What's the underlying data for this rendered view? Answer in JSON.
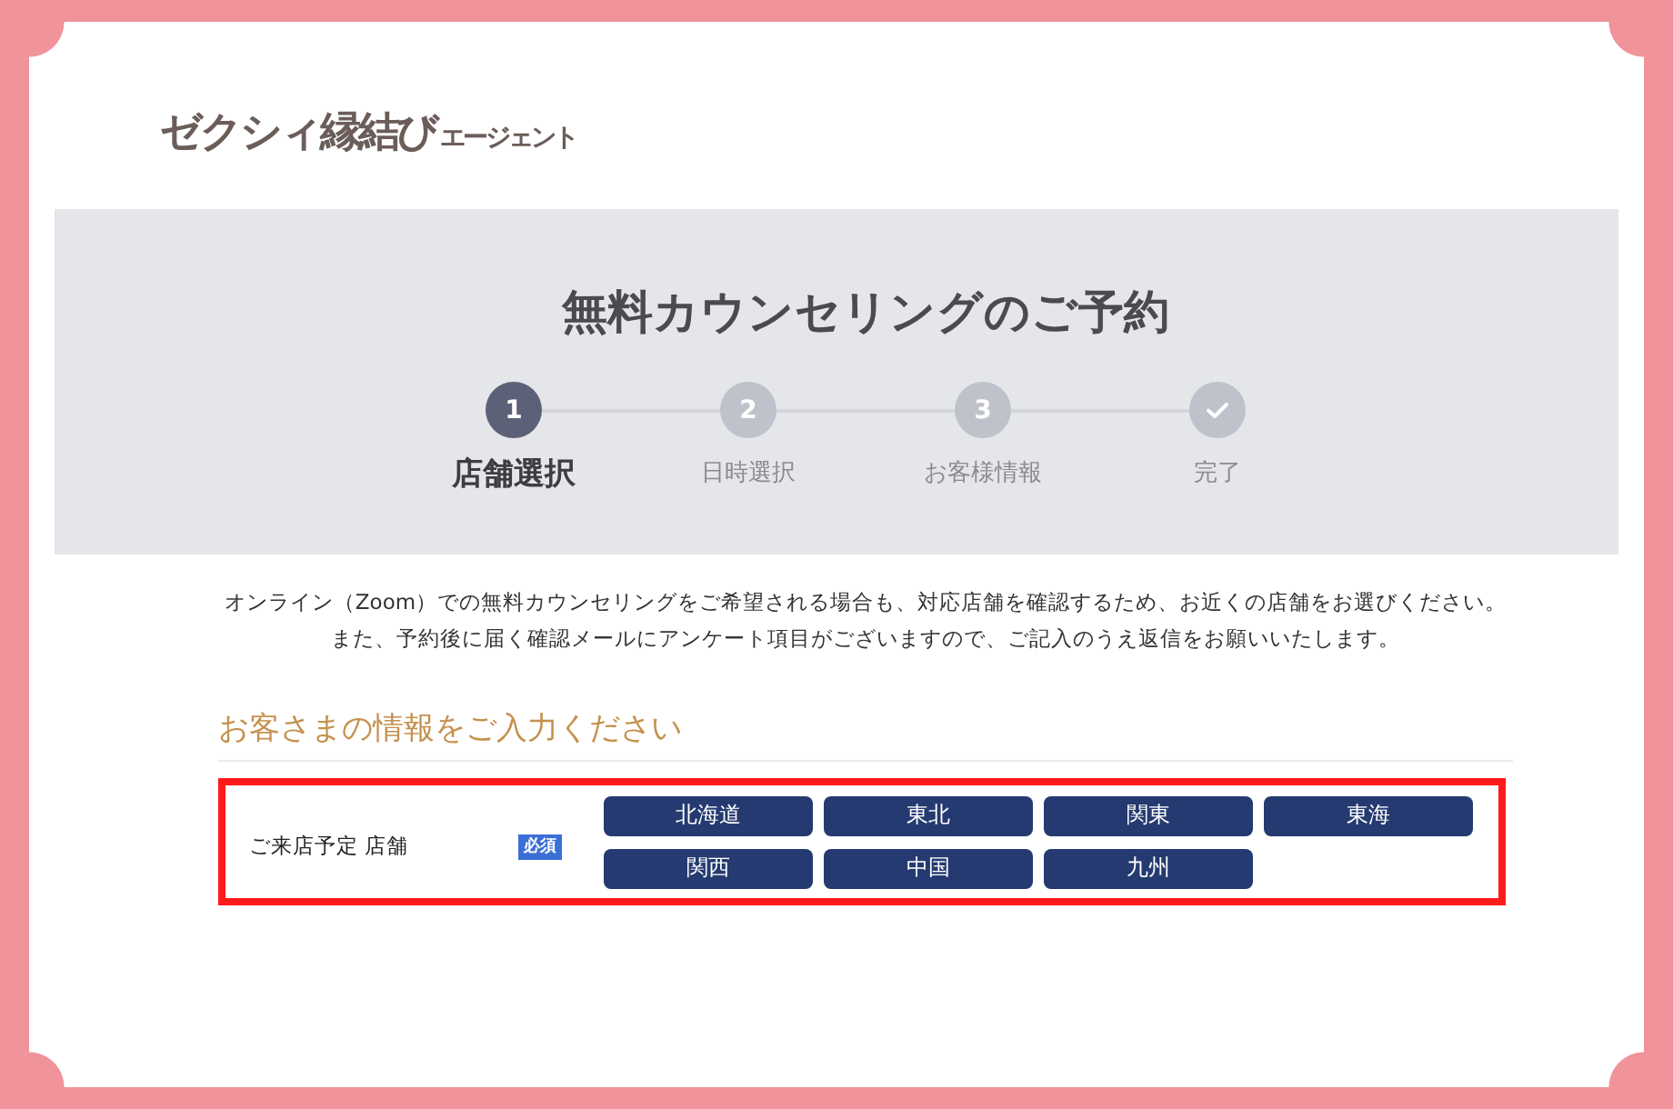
{
  "logo": {
    "text": "ゼクシィ縁結び",
    "suffix": "エージェント"
  },
  "header": {
    "title": "無料カウンセリングのご予約",
    "steps": [
      {
        "kind": "number",
        "number": "1",
        "label": "店舗選択",
        "selected": true
      },
      {
        "kind": "number",
        "number": "2",
        "label": "日時選択",
        "selected": false
      },
      {
        "kind": "number",
        "number": "3",
        "label": "お客様情報",
        "selected": false
      },
      {
        "kind": "check",
        "label": "完了",
        "selected": false
      }
    ]
  },
  "notice": [
    "オンライン（Zoom）での無料カウンセリングをご希望される場合も、対応店舗を確認するため、お近くの店舗をお選びください。",
    "また、予約後に届く確認メールにアンケート項目がございますので、ご記入のうえ返信をお願いいたします。"
  ],
  "section": {
    "heading": "お客さまの情報をご入力ください",
    "field": {
      "label": "ご来店予定 店舗",
      "required": true,
      "required_badge": "必須",
      "highlighted": true,
      "options": [
        "北海道",
        "東北",
        "関東",
        "東海",
        "関西",
        "中国",
        "九州"
      ]
    }
  }
}
